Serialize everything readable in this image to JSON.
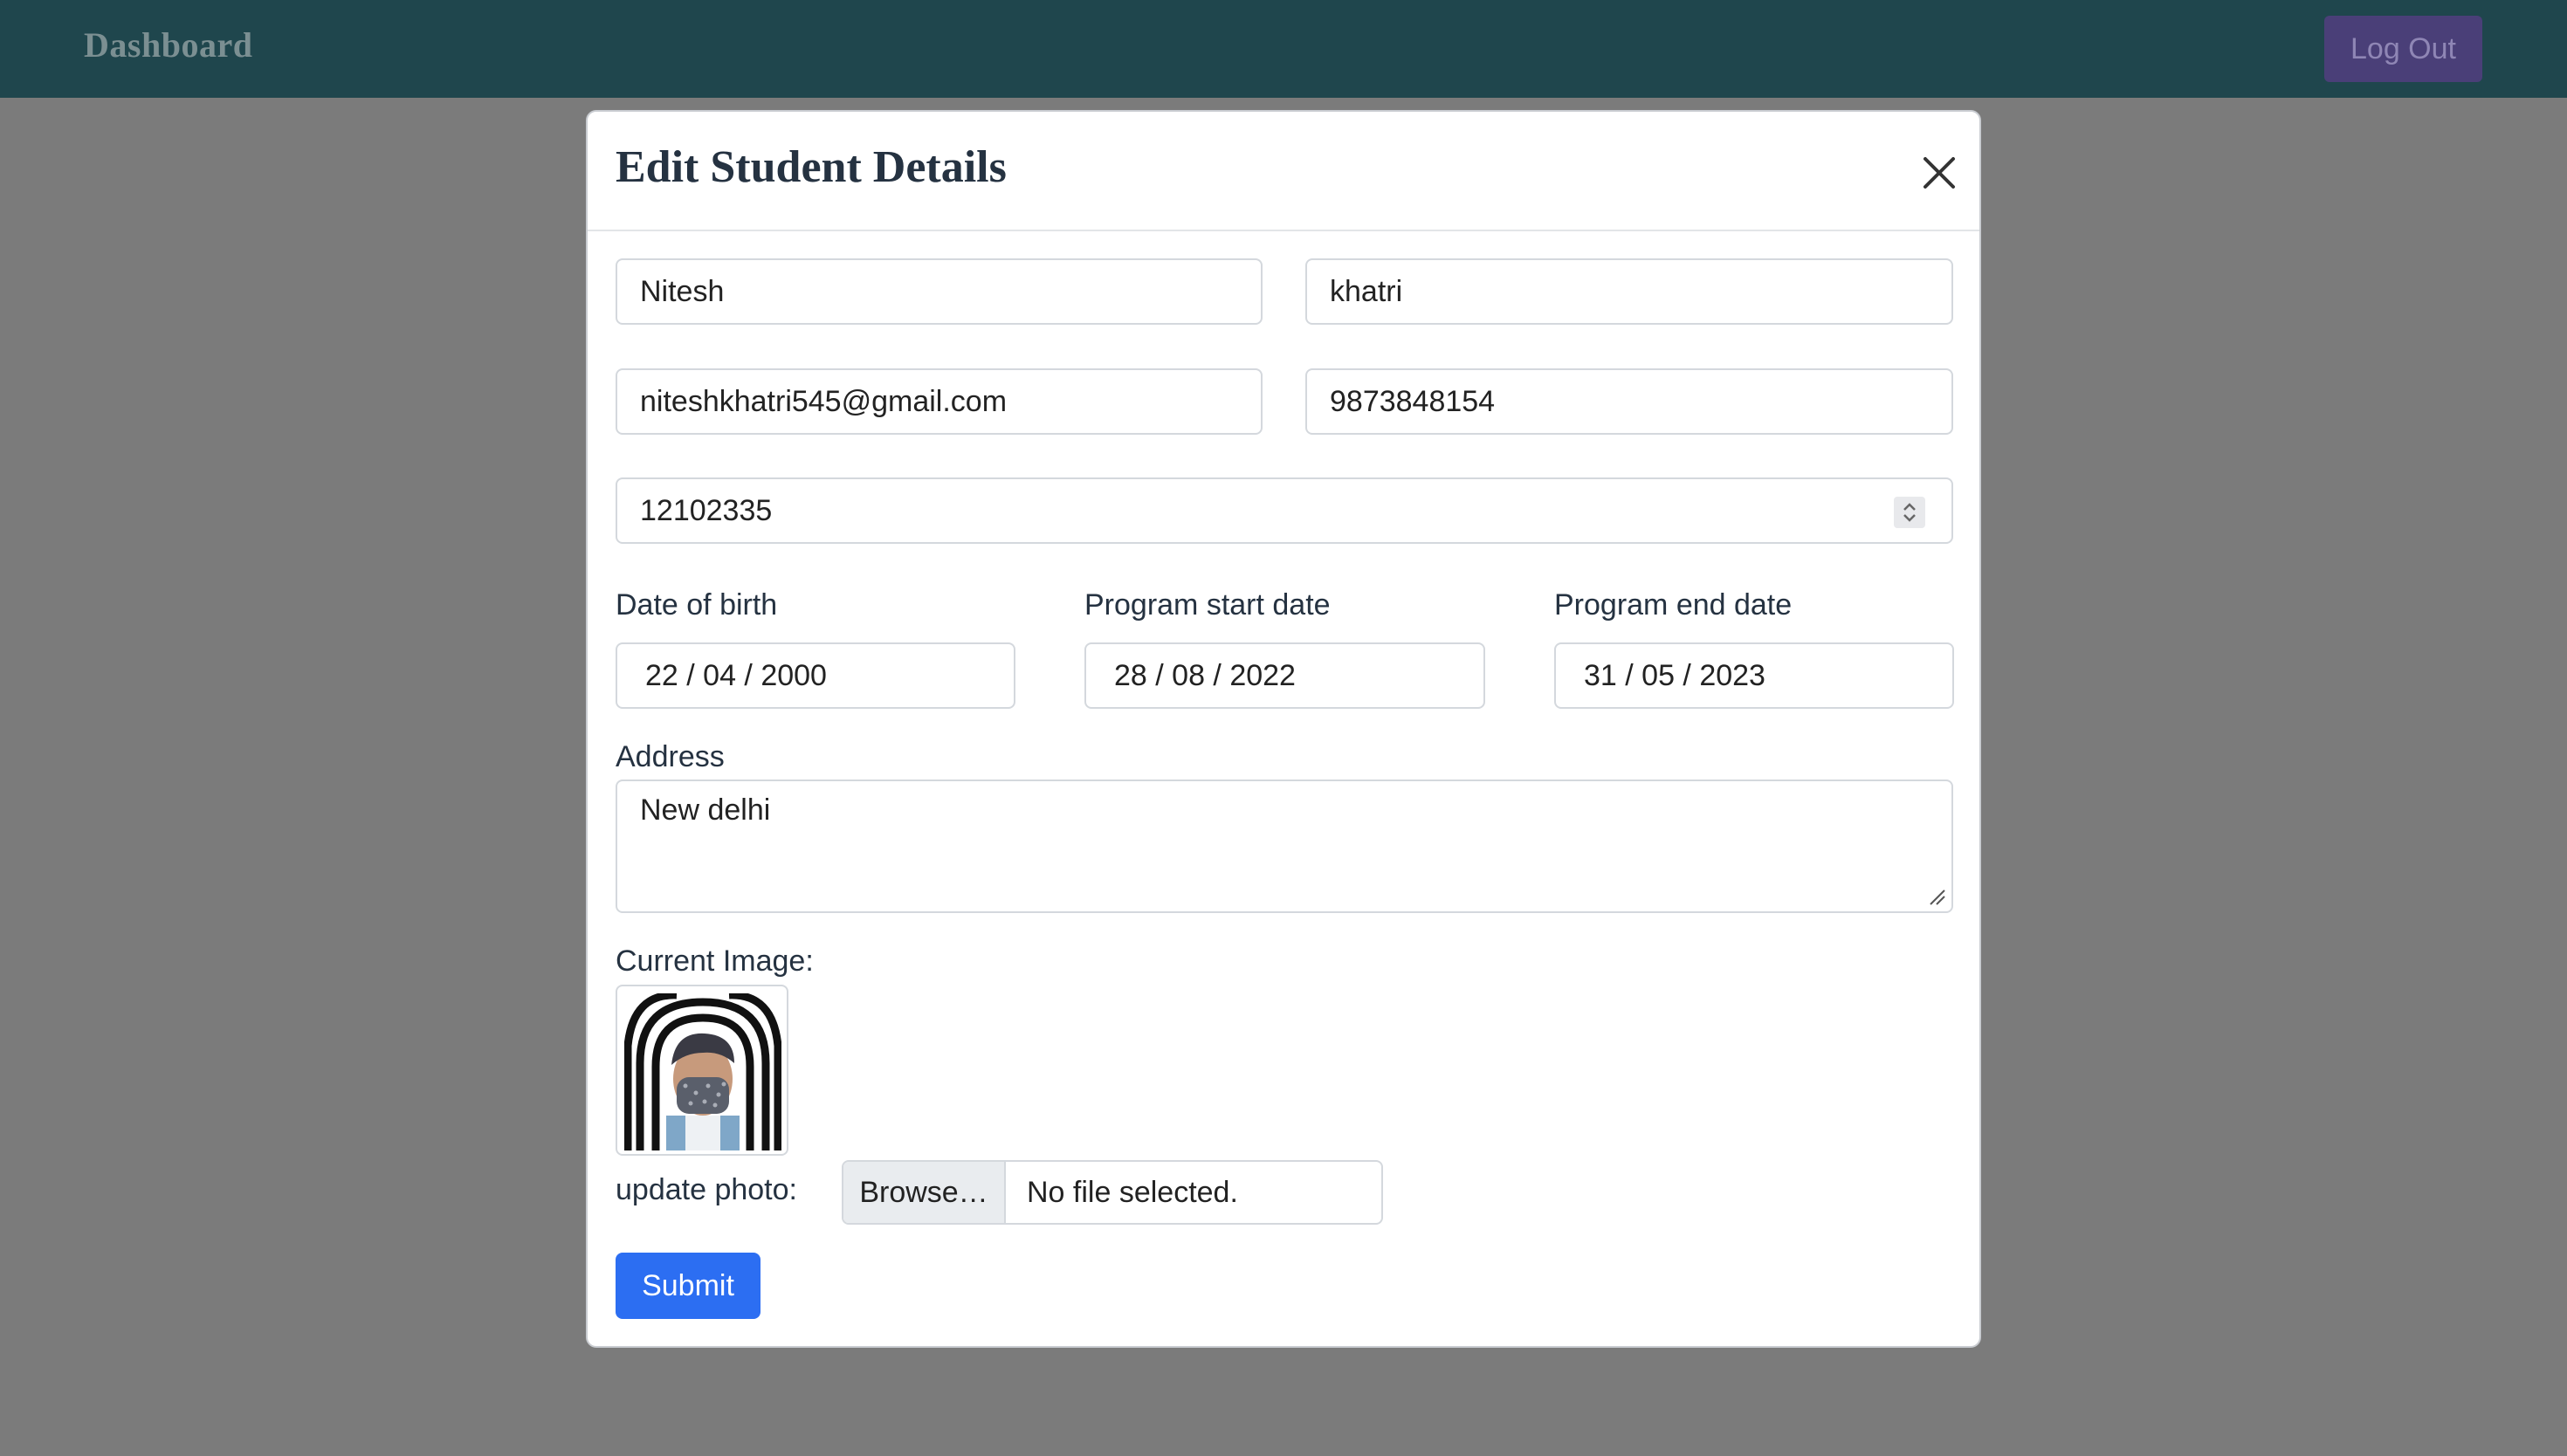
{
  "navbar": {
    "brand": "Dashboard",
    "logout_label": "Log Out"
  },
  "modal": {
    "title": "Edit Student Details",
    "fields": {
      "first_name": "Nitesh",
      "last_name": "khatri",
      "email": "niteshkhatri545@gmail.com",
      "phone": "9873848154",
      "roll_number": "12102335",
      "dob_label": "Date of birth",
      "dob_value": "22 / 04 / 2000",
      "start_label": "Program start date",
      "start_value": "28 / 08 / 2022",
      "end_label": "Program end date",
      "end_value": "31 / 05 / 2023",
      "address_label": "Address",
      "address_value": "New delhi",
      "current_image_label": "Current Image:",
      "update_photo_label": "update photo:",
      "browse_label": "Browse…",
      "file_status": "No file selected."
    },
    "submit_label": "Submit"
  },
  "icons": {
    "close": "close-icon",
    "spinner": "number-spinner-icon",
    "resize": "resize-handle-icon",
    "photo": "student-photo"
  },
  "colors": {
    "navbar": "#1f464d",
    "accent": "#2c6ef2",
    "logout": "#4a3f78",
    "overlay": "#7b7b7b"
  }
}
